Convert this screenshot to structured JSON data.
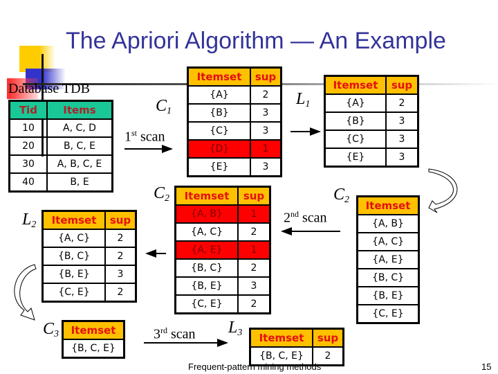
{
  "slide": {
    "title": "The Apriori Algorithm — An Example",
    "footer": "Frequent-pattern mining methods",
    "page_number": "15"
  },
  "database": {
    "title": "Database TDB",
    "headers": [
      "Tid",
      "Items"
    ],
    "rows": [
      [
        "10",
        "A, C, D"
      ],
      [
        "20",
        "B, C, E"
      ],
      [
        "30",
        "A, B, C, E"
      ],
      [
        "40",
        "B, E"
      ]
    ]
  },
  "labels": {
    "c1": "C",
    "c1_sub": "1",
    "l1": "L",
    "l1_sub": "1",
    "c2_left": "C",
    "c2_left_sub": "2",
    "c2_right": "C",
    "c2_right_sub": "2",
    "l2": "L",
    "l2_sub": "2",
    "c3": "C",
    "c3_sub": "3",
    "l3": "L",
    "l3_sub": "3"
  },
  "scans": {
    "first": {
      "num": "1",
      "suffix": "st",
      "word": "scan"
    },
    "second": {
      "num": "2",
      "suffix": "nd",
      "word": "scan"
    },
    "third": {
      "num": "3",
      "suffix": "rd",
      "word": "scan"
    }
  },
  "c1_table": {
    "headers": [
      "Itemset",
      "sup"
    ],
    "rows": [
      {
        "itemset": "{A}",
        "sup": "2",
        "pruned": false
      },
      {
        "itemset": "{B}",
        "sup": "3",
        "pruned": false
      },
      {
        "itemset": "{C}",
        "sup": "3",
        "pruned": false
      },
      {
        "itemset": "{D}",
        "sup": "1",
        "pruned": true
      },
      {
        "itemset": "{E}",
        "sup": "3",
        "pruned": false
      }
    ]
  },
  "l1_table": {
    "headers": [
      "Itemset",
      "sup"
    ],
    "rows": [
      {
        "itemset": "{A}",
        "sup": "2"
      },
      {
        "itemset": "{B}",
        "sup": "3"
      },
      {
        "itemset": "{C}",
        "sup": "3"
      },
      {
        "itemset": "{E}",
        "sup": "3"
      }
    ]
  },
  "c2_candidates": {
    "headers": [
      "Itemset"
    ],
    "rows": [
      "{A, B}",
      "{A, C}",
      "{A, E}",
      "{B, C}",
      "{B, E}",
      "{C, E}"
    ]
  },
  "c2_table": {
    "headers": [
      "Itemset",
      "sup"
    ],
    "rows": [
      {
        "itemset": "{A, B}",
        "sup": "1",
        "pruned": true
      },
      {
        "itemset": "{A, C}",
        "sup": "2",
        "pruned": false
      },
      {
        "itemset": "{A, E}",
        "sup": "1",
        "pruned": true
      },
      {
        "itemset": "{B, C}",
        "sup": "2",
        "pruned": false
      },
      {
        "itemset": "{B, E}",
        "sup": "3",
        "pruned": false
      },
      {
        "itemset": "{C, E}",
        "sup": "2",
        "pruned": false
      }
    ]
  },
  "l2_table": {
    "headers": [
      "Itemset",
      "sup"
    ],
    "rows": [
      {
        "itemset": "{A, C}",
        "sup": "2"
      },
      {
        "itemset": "{B, C}",
        "sup": "2"
      },
      {
        "itemset": "{B, E}",
        "sup": "3"
      },
      {
        "itemset": "{C, E}",
        "sup": "2"
      }
    ]
  },
  "c3_table": {
    "headers": [
      "Itemset"
    ],
    "rows": [
      "{B, C, E}"
    ]
  },
  "l3_table": {
    "headers": [
      "Itemset",
      "sup"
    ],
    "rows": [
      {
        "itemset": "{B, C, E}",
        "sup": "2"
      }
    ]
  },
  "colors": {
    "title": "#333399",
    "header_bg": "#ffc000",
    "header_text": "#e51010",
    "db_header_bg": "#19c896",
    "pruned_bg": "#ff0000"
  }
}
